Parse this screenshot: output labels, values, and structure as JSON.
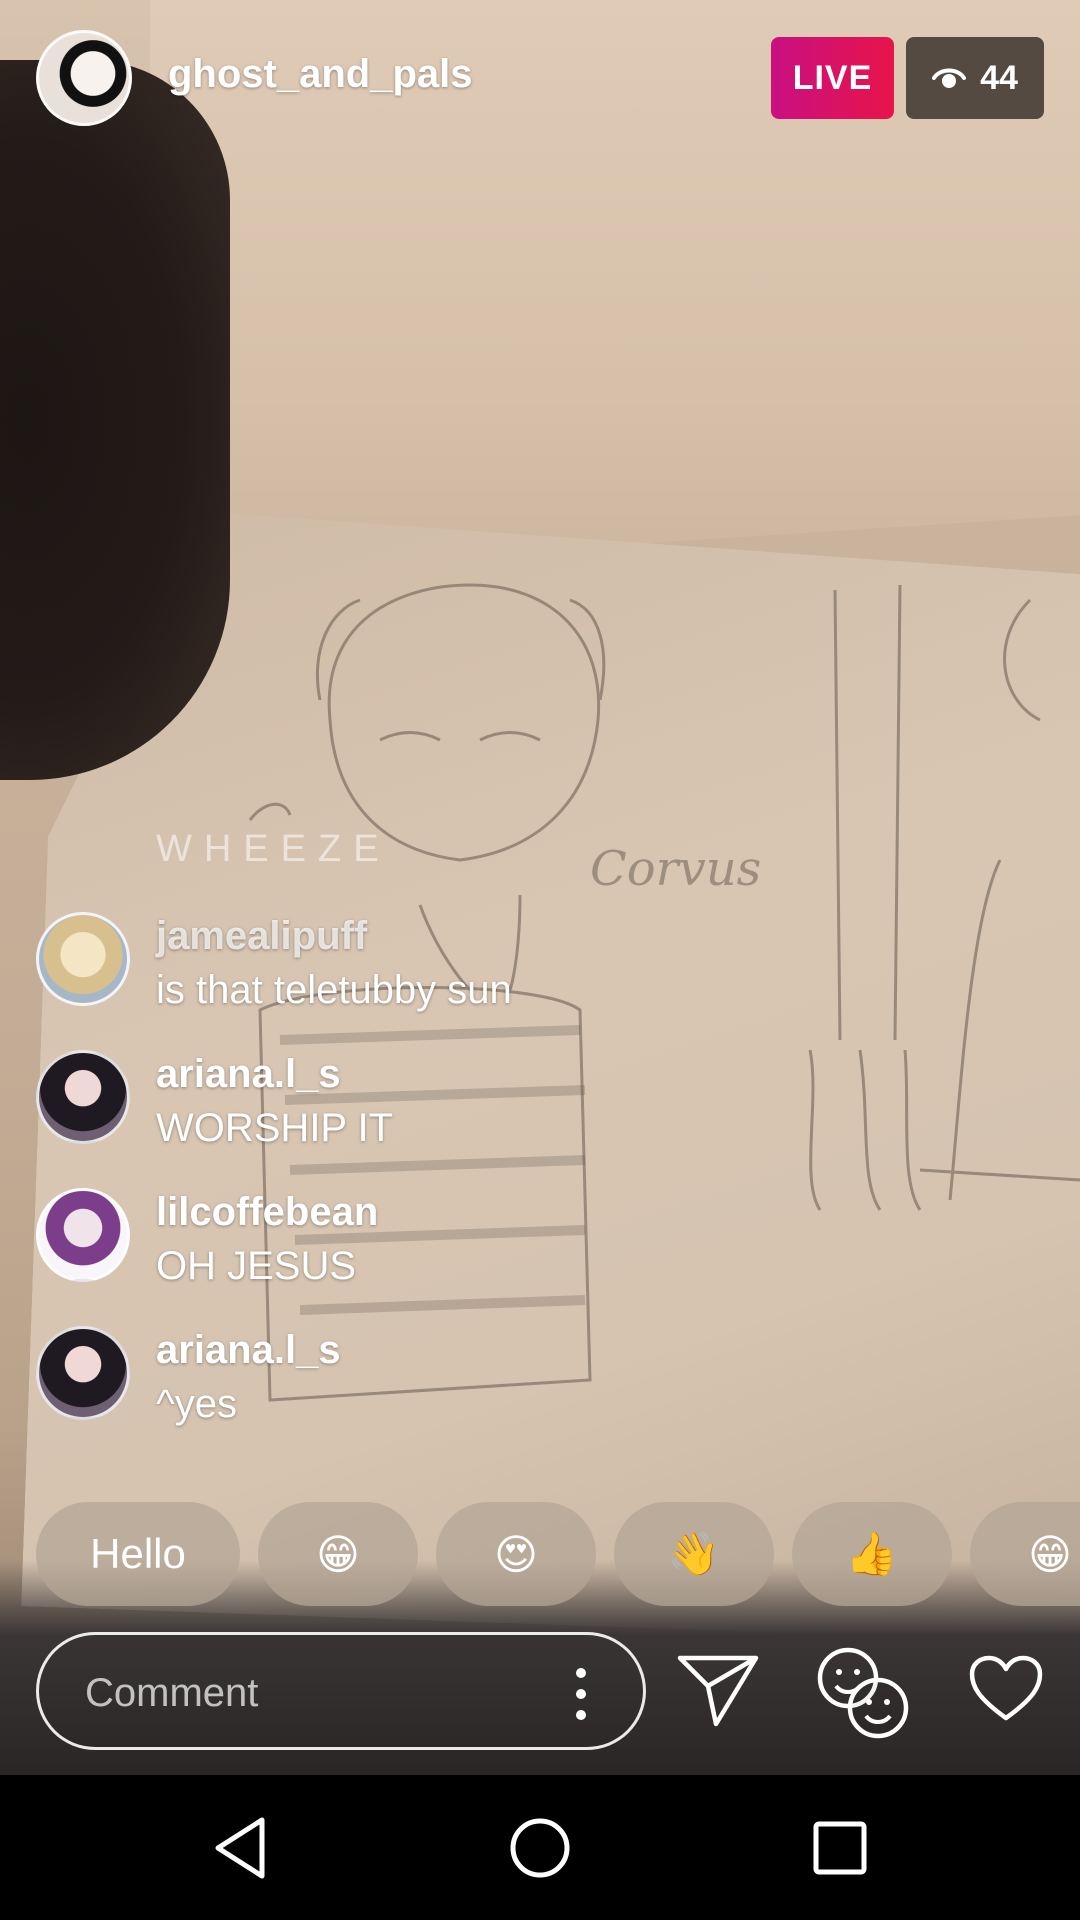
{
  "header": {
    "host_username": "ghost_and_pals",
    "live_label": "LIVE",
    "viewer_count": "44"
  },
  "faded_comment": "WHEEZE",
  "comments": [
    {
      "user": "jamealipuff",
      "text": "is that teletubby sun"
    },
    {
      "user": "ariana.l_s",
      "text": "WORSHIP IT"
    },
    {
      "user": "lilcoffebean",
      "text": "OH JESUS"
    },
    {
      "user": "ariana.l_s",
      "text": "^yes"
    }
  ],
  "quick_replies": [
    "Hello",
    "😁",
    "😍",
    "👋",
    "👍",
    "😁"
  ],
  "composer": {
    "placeholder": "Comment"
  },
  "colors": {
    "live_start": "#c90f82",
    "live_end": "#e8144a"
  },
  "icons": {
    "more": "more-vertical-icon",
    "send": "direct-send-icon",
    "faces": "face-filter-icon",
    "heart": "heart-icon",
    "viewers": "eye-icon",
    "nav_back": "back-triangle-icon",
    "nav_home": "home-circle-icon",
    "nav_recents": "recents-square-icon"
  }
}
